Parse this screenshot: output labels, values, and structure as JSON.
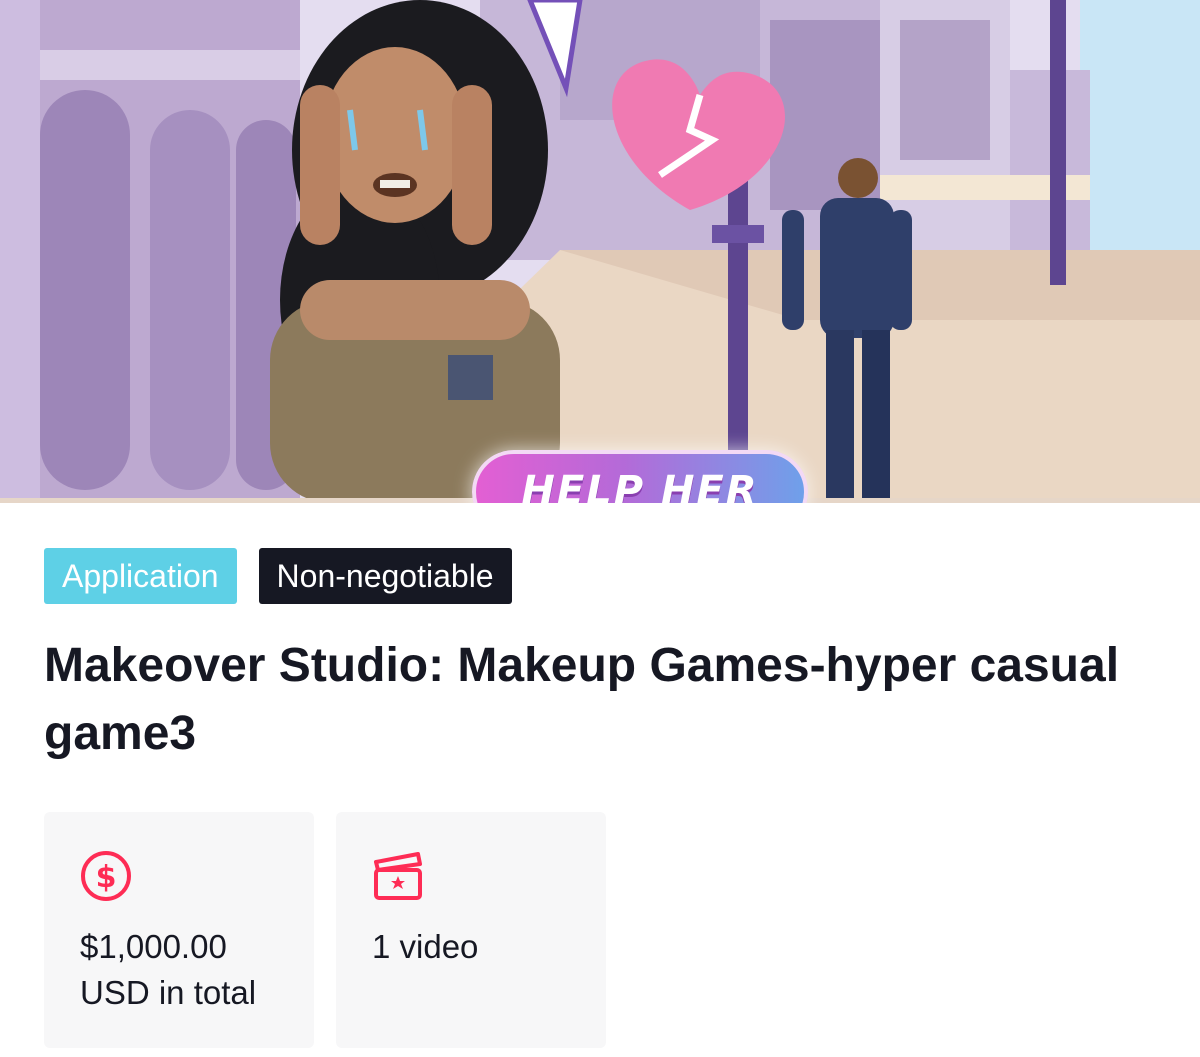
{
  "hero": {
    "image_description": "Game screenshot: crying character on a street, broken heart, man walking away",
    "button_label": "HELP HER"
  },
  "tags": {
    "type_label": "Application",
    "price_label": "Non-negotiable"
  },
  "title": "Makeover Studio: Makeup Games-hyper casual game3",
  "cards": {
    "budget": {
      "icon": "dollar-icon",
      "amount": "$1,000.00",
      "unit": "USD in total"
    },
    "video": {
      "icon": "video-clapper-icon",
      "count": "1 video"
    }
  },
  "colors": {
    "accent": "#fe2c55",
    "tag_application_bg": "#5ed0e6",
    "tag_negotiable_bg": "#161823",
    "card_bg": "#f7f7f8"
  }
}
